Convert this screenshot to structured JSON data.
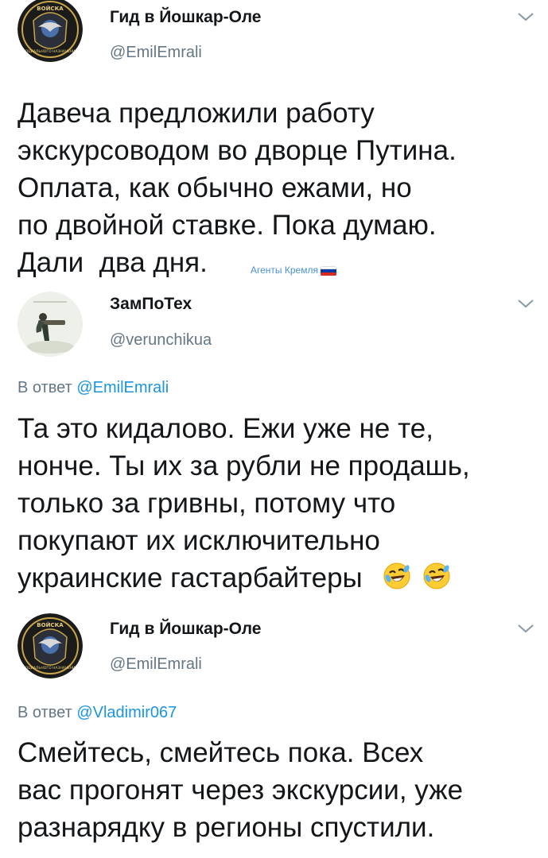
{
  "tweets": [
    {
      "author": {
        "name": "Гид в Йошкар-Оле",
        "handle": "@EmilEmrali",
        "avatar_text": "ВОЙСКА",
        "avatar_bottom_text": "СОЦИАЛЬНОГО НАЗНАЧЕНИЯ"
      },
      "menu_icon": "chevron-down-icon",
      "lines": [
        "Давеча предложили работу",
        "экскурсоводом во дворце Путина.",
        "Оплата, как обычно ежами, но",
        "по двойной ставке. Пока думаю.",
        "Дали  два дня."
      ],
      "watermark": "Агенты Кремля"
    },
    {
      "author": {
        "name": "ЗамПоТех",
        "handle": "@verunchikua"
      },
      "menu_icon": "chevron-down-icon",
      "reply_prefix": "В ответ",
      "reply_to": "@EmilEmrali",
      "lines": [
        "Та это кидалово. Ежи уже не те,",
        "нонче. Ты их за рубли не продашь,",
        "только за гривны, потому что",
        "покупают их исключительно",
        "украинские гастарбайтеры"
      ],
      "emojis": [
        "rolling-on-floor-laughing-emoji",
        "rolling-on-floor-laughing-emoji"
      ]
    },
    {
      "author": {
        "name": "Гид в Йошкар-Оле",
        "handle": "@EmilEmrali",
        "avatar_text": "ВОЙСКА",
        "avatar_bottom_text": "СОЦИАЛЬНОГО НАЗНАЧЕНИЯ"
      },
      "menu_icon": "chevron-down-icon",
      "reply_prefix": "В ответ",
      "reply_to": "@Vladimir067",
      "lines": [
        "Смейтесь, смейтесь пока. Всех",
        "вас прогонят через экскурсии, уже",
        "разнарядку в регионы спустили."
      ]
    }
  ],
  "colors": {
    "text": "#14171a",
    "secondary": "#657786",
    "link": "#1b95e0",
    "watermark": "#4a90d9",
    "flag": [
      "#ffffff",
      "#0039a6",
      "#d52b1e"
    ]
  }
}
